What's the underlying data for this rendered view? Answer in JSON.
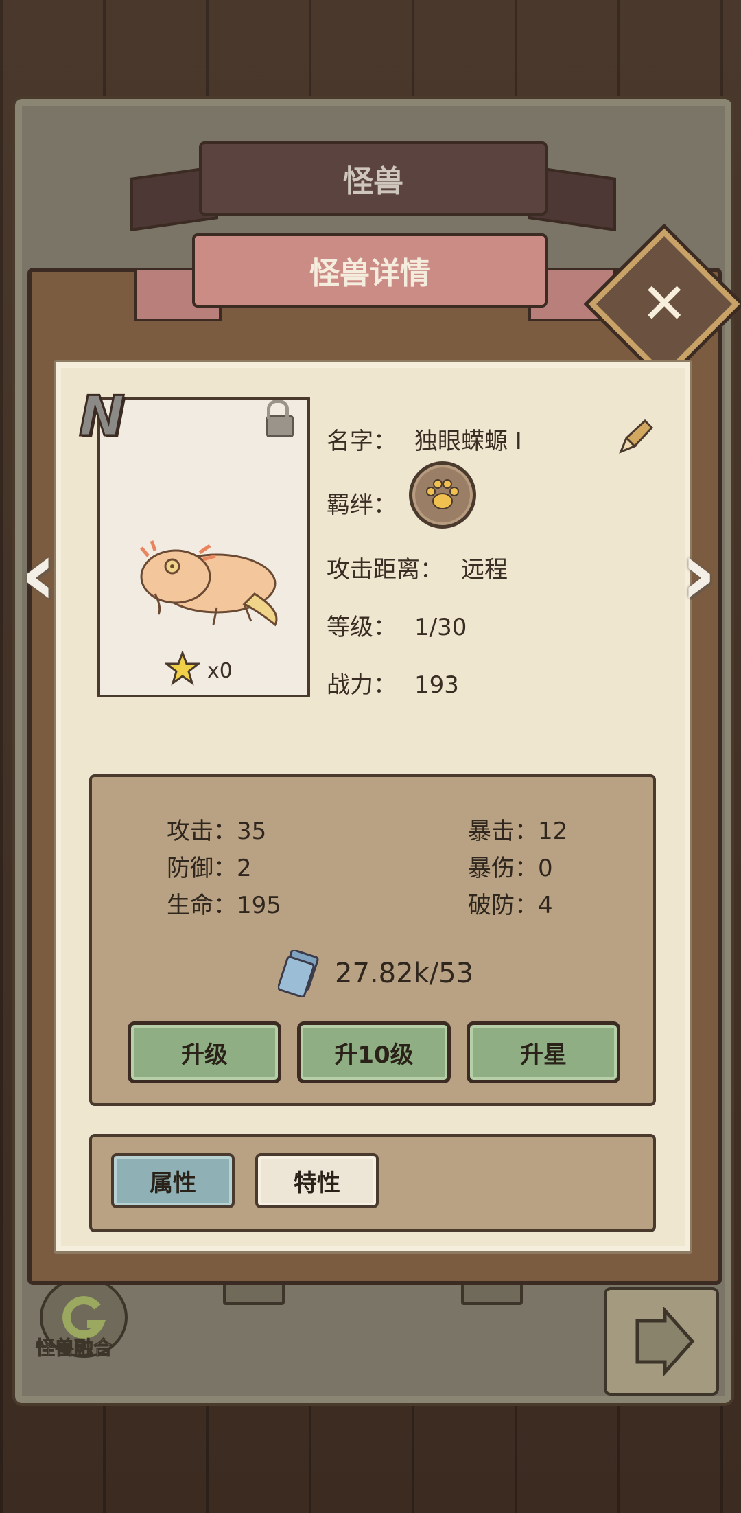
{
  "header": {
    "title": "怪兽"
  },
  "dialog": {
    "title": "怪兽详情",
    "close_label": "✕"
  },
  "card": {
    "rarity": "N",
    "star_count": "x0"
  },
  "info": {
    "name_label": "名字：",
    "name_value": "独眼蝾螈 I",
    "bond_label": "羁绊：",
    "range_label": "攻击距离：",
    "range_value": "远程",
    "level_label": "等级：",
    "level_value": "1/30",
    "power_label": "战力：",
    "power_value": "193"
  },
  "stats": {
    "attack": "攻击：35",
    "defense": "防御：2",
    "hp": "生命：195",
    "crit": "暴击：12",
    "crit_dmg": "暴伤：0",
    "armor_pen": "破防：4",
    "exp": "27.82k/53"
  },
  "buttons": {
    "level_up": "升级",
    "level_up_10": "升10级",
    "star_up": "升星"
  },
  "tabs": {
    "attributes": "属性",
    "traits": "特性"
  },
  "background": {
    "fusion_label": "怪兽融合"
  },
  "icons": {
    "close": "close-icon",
    "lock": "unlock-icon",
    "star": "star-icon",
    "pencil": "pencil-icon",
    "paw": "paw-icon",
    "book": "monster-book-icon"
  }
}
